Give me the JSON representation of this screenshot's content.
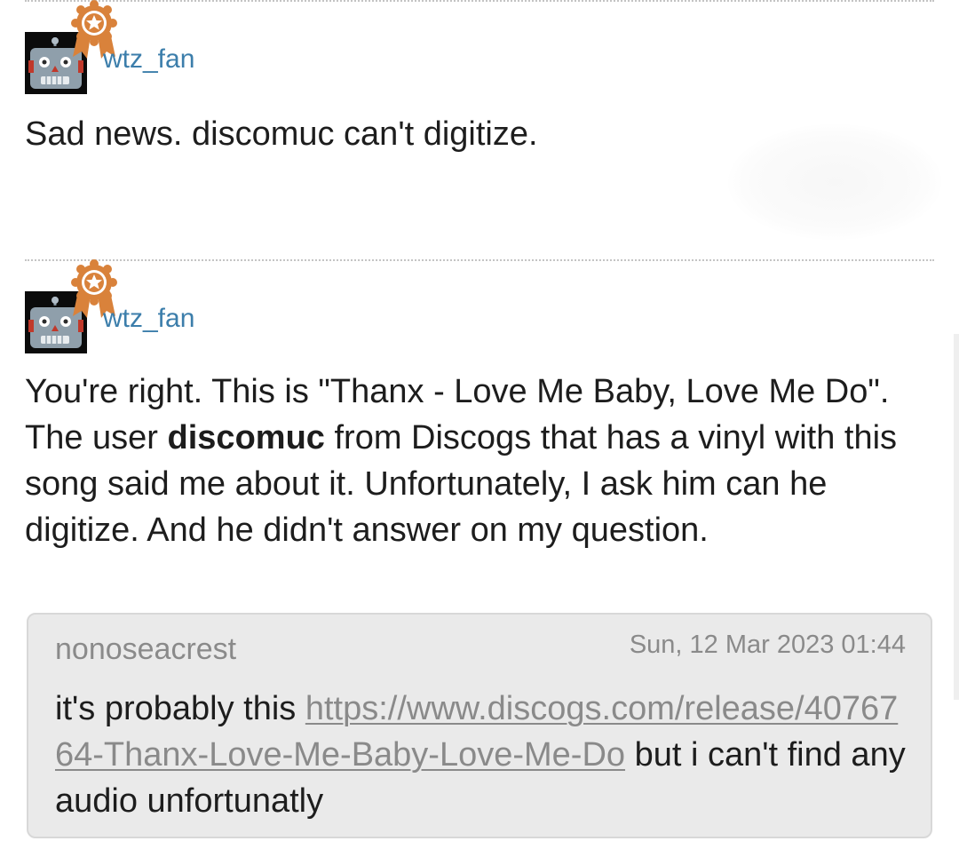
{
  "posts": [
    {
      "username": "wtz_fan",
      "avatar_icon": "robot-avatar-icon",
      "badge_icon": "award-badge-icon",
      "text": "Sad news. discomuc can't digitize."
    },
    {
      "username": "wtz_fan",
      "avatar_icon": "robot-avatar-icon",
      "badge_icon": "award-badge-icon",
      "text_parts": [
        "You're right. This is \"Thanx - Love Me Baby, Love Me Do\". The user ",
        "discomuc",
        " from Discogs that has a vinyl with this song said me about it. Unfortunately, I ask him can he digitize. And he didn't answer on my question."
      ],
      "quote": {
        "author": "nonoseacrest",
        "date": "Sun, 12 Mar 2023 01:44",
        "text_before": "it's probably this ",
        "link": "https://www.discogs.com/release/4076764-Thanx-Love-Me-Baby-Love-Me-Do",
        "text_after": " but i can't find any audio unfortunatly"
      }
    }
  ],
  "colors": {
    "username": "#3c7eab",
    "badge": "#d9823b",
    "quote_bg": "#eaeaea",
    "muted_text": "#8a8a8a",
    "divider": "#c4c4c4"
  }
}
